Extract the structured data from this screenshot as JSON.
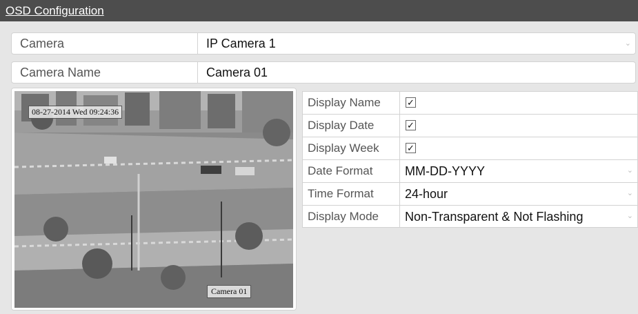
{
  "window": {
    "title": "OSD Configuration"
  },
  "camera": {
    "label": "Camera",
    "value": "IP Camera 1"
  },
  "camera_name": {
    "label": "Camera Name",
    "value": "Camera 01"
  },
  "preview": {
    "osd_date_text": "08-27-2014  Wed  09:24:36",
    "osd_name_text": "Camera 01"
  },
  "settings": {
    "display_name": {
      "label": "Display Name",
      "checked": true
    },
    "display_date": {
      "label": "Display Date",
      "checked": true
    },
    "display_week": {
      "label": "Display Week",
      "checked": true
    },
    "date_format": {
      "label": "Date Format",
      "value": "MM-DD-YYYY"
    },
    "time_format": {
      "label": "Time Format",
      "value": "24-hour"
    },
    "display_mode": {
      "label": "Display Mode",
      "value": "Non-Transparent & Not Flashing"
    }
  },
  "icons": {
    "checkbox_checked": "✓",
    "chevron": "⌄"
  }
}
